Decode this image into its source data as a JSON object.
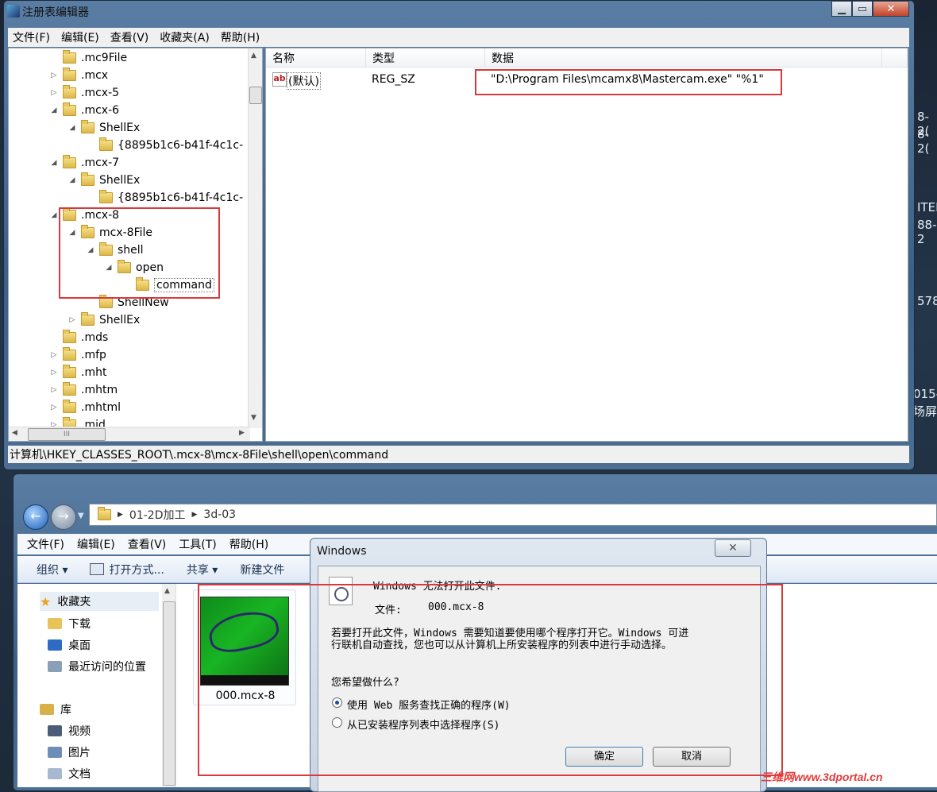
{
  "regedit": {
    "title": "注册表编辑器",
    "menu": [
      "文件(F)",
      "编辑(E)",
      "查看(V)",
      "收藏夹(A)",
      "帮助(H)"
    ],
    "tree": [
      {
        "label": ".mc9File",
        "expander": ""
      },
      {
        "label": ".mcx",
        "expander": "▷"
      },
      {
        "label": ".mcx-5",
        "expander": "▷"
      },
      {
        "label": ".mcx-6",
        "expander": "◢"
      },
      {
        "label": "ShellEx",
        "expander": "◢"
      },
      {
        "label": "{8895b1c6-b41f-4c1c-",
        "expander": ""
      },
      {
        "label": ".mcx-7",
        "expander": "◢"
      },
      {
        "label": "ShellEx",
        "expander": "◢"
      },
      {
        "label": "{8895b1c6-b41f-4c1c-",
        "expander": ""
      },
      {
        "label": ".mcx-8",
        "expander": "◢"
      },
      {
        "label": "mcx-8File",
        "expander": "◢"
      },
      {
        "label": "shell",
        "expander": "◢"
      },
      {
        "label": "open",
        "expander": "◢"
      },
      {
        "label": "command",
        "expander": ""
      },
      {
        "label": "ShellNew",
        "expander": ""
      },
      {
        "label": "ShellEx",
        "expander": "▷"
      },
      {
        "label": ".mds",
        "expander": ""
      },
      {
        "label": ".mfp",
        "expander": "▷"
      },
      {
        "label": ".mht",
        "expander": "▷"
      },
      {
        "label": ".mhtm",
        "expander": "▷"
      },
      {
        "label": ".mhtml",
        "expander": "▷"
      },
      {
        "label": ".mid",
        "expander": "▷"
      }
    ],
    "columns": {
      "name": "名称",
      "type": "类型",
      "data": "数据"
    },
    "values": [
      {
        "icon": "ab",
        "name": "(默认)",
        "type": "REG_SZ",
        "data": "\"D:\\Program Files\\mcamx8\\Mastercam.exe\" \"%1\""
      }
    ],
    "status": "计算机\\HKEY_CLASSES_ROOT\\.mcx-8\\mcx-8File\\shell\\open\\command",
    "hscroll_grip": "III"
  },
  "explorer": {
    "path": [
      "01-2D加工",
      "3d-03"
    ],
    "menu": [
      "文件(F)",
      "编辑(E)",
      "查看(V)",
      "工具(T)",
      "帮助(H)"
    ],
    "toolbar": [
      "组织 ▾",
      "打开方式...",
      "共享 ▾",
      "新建文件"
    ],
    "nav": {
      "favorites_label": "收藏夹",
      "favorites": [
        "下载",
        "桌面",
        "最近访问的位置"
      ],
      "library_label": "库",
      "library": [
        "视频",
        "图片",
        "文档"
      ]
    },
    "file": {
      "name": "000.mcx-8"
    }
  },
  "dialog": {
    "title": "Windows",
    "close": "✕",
    "heading": "Windows 无法打开此文件:",
    "file_label": "文件:",
    "file_value": "000.mcx-8",
    "message_line1": "若要打开此文件，Windows 需要知道要使用哪个程序打开它。Windows 可进",
    "message_line2": "行联机自动查找，您也可以从计算机上所安装程序的列表中进行手动选择。",
    "question": "您希望做什么?",
    "options": [
      {
        "label": "使用 Web 服务查找正确的程序(W)",
        "selected": true
      },
      {
        "label": "从已安装程序列表中选择程序(S)",
        "selected": false
      }
    ],
    "ok": "确定",
    "cancel": "取消"
  },
  "desktop_fragments": [
    "8-2(",
    "8-2(",
    "ITEI",
    "88-2",
    "578.",
    "015-",
    "场屏"
  ],
  "watermark": "三维网www.3dportal.cn",
  "colors": {
    "highlight": "#d9393c",
    "titlebar": "#4c6e93"
  }
}
